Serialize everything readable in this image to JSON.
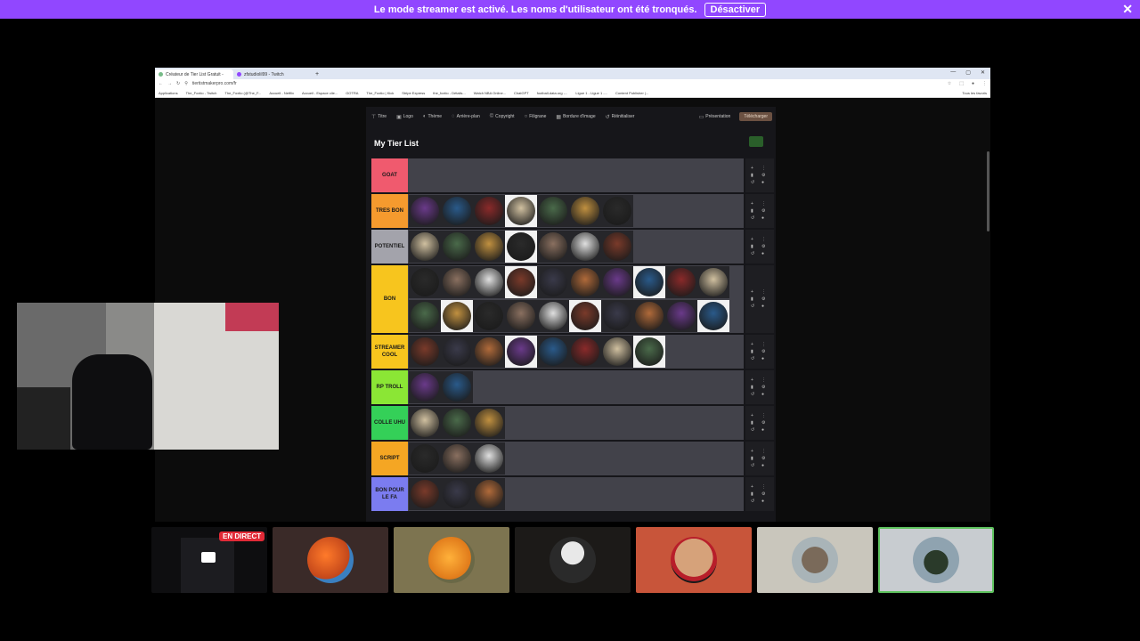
{
  "banner": {
    "message": "Le mode streamer est activé. Les noms d'utilisateur ont été tronqués.",
    "button": "Désactiver",
    "close": "✕",
    "color": "#9147ff"
  },
  "browser": {
    "tabs": [
      {
        "label": "Créateur de Tier List Gratuit -"
      },
      {
        "label": "zfstudiolil99 - Twitch"
      }
    ],
    "url": "tiertistmakerpro.com/fr",
    "bookmarks": [
      "Applications",
      "The_Foxtio - Twitch",
      "The_Foxtio (@The_F...",
      "Accueil - Netflix",
      "Accueil - Espace clie...",
      "GOTRA",
      "The_Foxtio | Kick",
      "Stripe Express",
      "the_foxtio - Détails...",
      "Watch NBA Online...",
      "ChatGPT",
      "football-data.org -...",
      "Ligue 1 - Ligue 1 -...",
      "Content Publisher |...",
      "Tous les favoris"
    ]
  },
  "app": {
    "toolbar": [
      "Titre",
      "Logo",
      "Thème",
      "Arrière-plan",
      "Copyright",
      "Filigrane",
      "Bordure d'image",
      "Réinitialiser"
    ],
    "presentation": "Présentation",
    "download": "Télécharger",
    "list_title": "My Tier List"
  },
  "tiers": [
    {
      "label": "GOAT",
      "color": "#f05a6e",
      "count": 0
    },
    {
      "label": "TRES BON",
      "color": "#f59a2e",
      "count": 7
    },
    {
      "label": "POTENTIEL",
      "color": "#a3a3ab",
      "count": 7
    },
    {
      "label": "BON",
      "color": "#f7c51e",
      "count": 20
    },
    {
      "label": "STREAMER COOL",
      "color": "#f7c51e",
      "count": 8
    },
    {
      "label": "RP TROLL",
      "color": "#8be635",
      "count": 2
    },
    {
      "label": "COLLE UHU",
      "color": "#34d058",
      "count": 3
    },
    {
      "label": "SCRIPT",
      "color": "#f5a623",
      "count": 3
    },
    {
      "label": "BON POUR LE FA",
      "color": "#7b7cf0",
      "count": 3
    }
  ],
  "participants": {
    "live_label": "EN DIRECT"
  }
}
